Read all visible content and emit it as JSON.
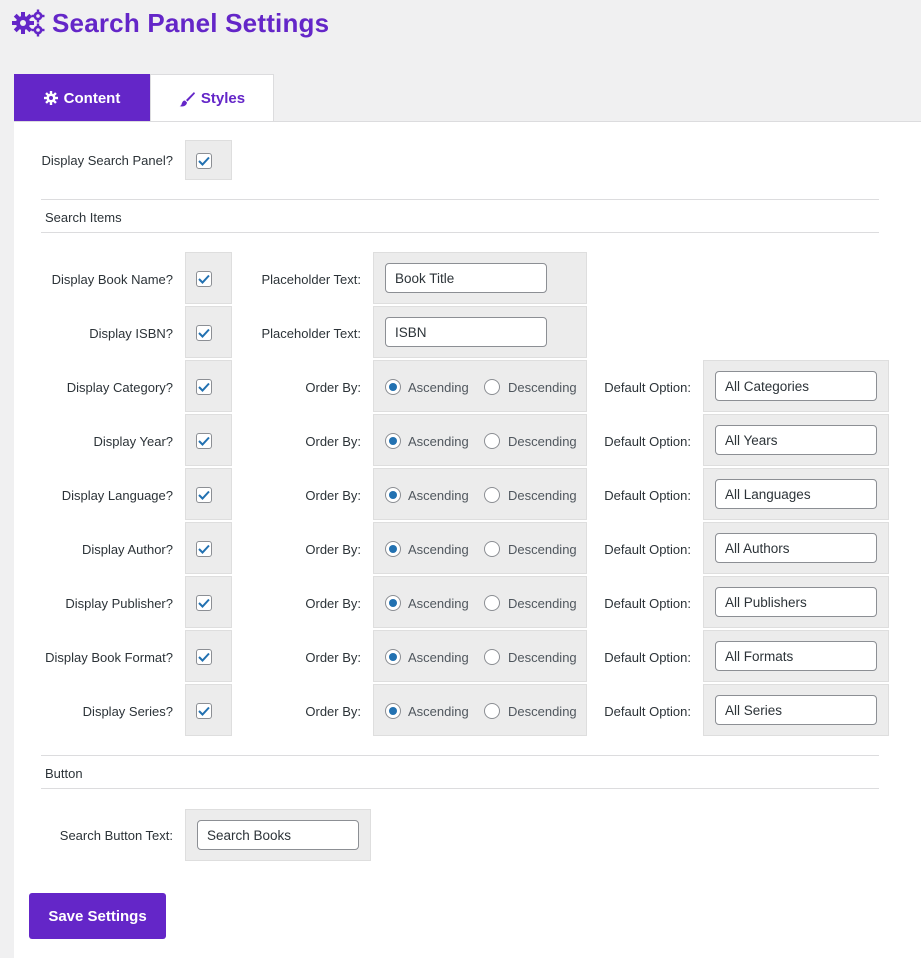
{
  "page": {
    "title": "Search Panel Settings",
    "accent": "#6426c8"
  },
  "tabs": [
    {
      "label": "Content",
      "icon": "gear-icon",
      "active": true
    },
    {
      "label": "Styles",
      "icon": "brush-icon",
      "active": false
    }
  ],
  "display_search_panel": {
    "label": "Display Search Panel?",
    "checked": true
  },
  "sections": {
    "search_items": "Search Items",
    "button": "Button"
  },
  "placeholder_rows": [
    {
      "label": "Display Book Name?",
      "checked": true,
      "field_label": "Placeholder Text:",
      "value": "Book Title"
    },
    {
      "label": "Display ISBN?",
      "checked": true,
      "field_label": "Placeholder Text:",
      "value": "ISBN"
    }
  ],
  "order_rows": [
    {
      "label": "Display Category?",
      "checked": true,
      "order_label": "Order By:",
      "asc": "Ascending",
      "desc": "Descending",
      "selected": "asc",
      "default_label": "Default Option:",
      "default_value": "All Categories"
    },
    {
      "label": "Display Year?",
      "checked": true,
      "order_label": "Order By:",
      "asc": "Ascending",
      "desc": "Descending",
      "selected": "asc",
      "default_label": "Default Option:",
      "default_value": "All Years"
    },
    {
      "label": "Display Language?",
      "checked": true,
      "order_label": "Order By:",
      "asc": "Ascending",
      "desc": "Descending",
      "selected": "asc",
      "default_label": "Default Option:",
      "default_value": "All Languages"
    },
    {
      "label": "Display Author?",
      "checked": true,
      "order_label": "Order By:",
      "asc": "Ascending",
      "desc": "Descending",
      "selected": "asc",
      "default_label": "Default Option:",
      "default_value": "All Authors"
    },
    {
      "label": "Display Publisher?",
      "checked": true,
      "order_label": "Order By:",
      "asc": "Ascending",
      "desc": "Descending",
      "selected": "asc",
      "default_label": "Default Option:",
      "default_value": "All Publishers"
    },
    {
      "label": "Display Book Format?",
      "checked": true,
      "order_label": "Order By:",
      "asc": "Ascending",
      "desc": "Descending",
      "selected": "asc",
      "default_label": "Default Option:",
      "default_value": "All Formats"
    },
    {
      "label": "Display Series?",
      "checked": true,
      "order_label": "Order By:",
      "asc": "Ascending",
      "desc": "Descending",
      "selected": "asc",
      "default_label": "Default Option:",
      "default_value": "All Series"
    }
  ],
  "search_button": {
    "label": "Search Button Text:",
    "value": "Search Books"
  },
  "save_button": {
    "label": "Save Settings"
  }
}
